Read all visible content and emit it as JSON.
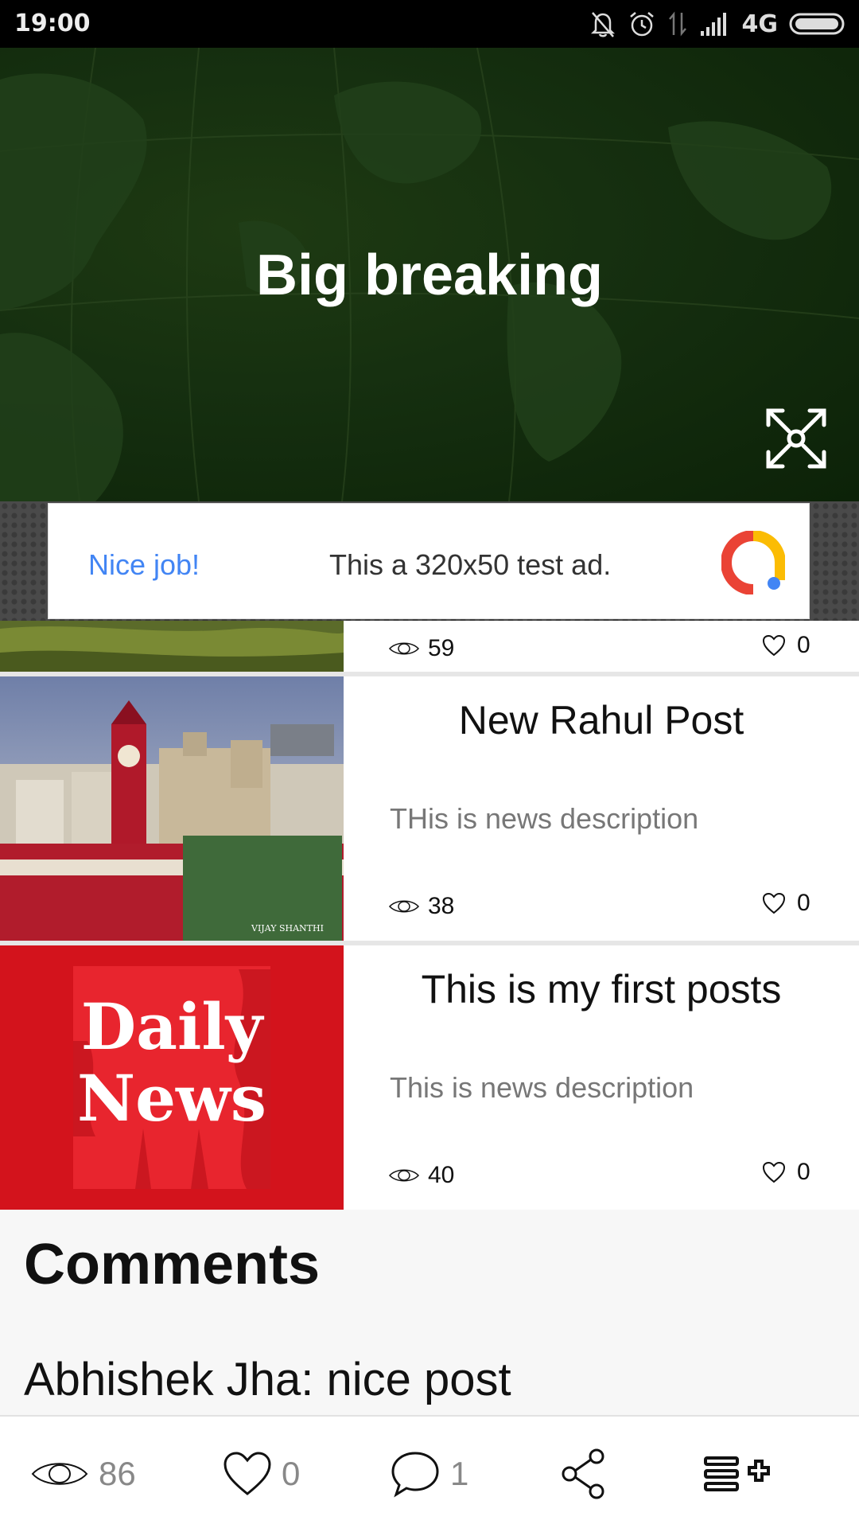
{
  "status_bar": {
    "time": "19:00",
    "network": "4G"
  },
  "hero": {
    "title": "Big breaking"
  },
  "ad": {
    "headline": "Nice job!",
    "text": "This a 320x50 test ad."
  },
  "news": [
    {
      "title": "",
      "description": "",
      "views": "59",
      "likes": "0"
    },
    {
      "title": "New Rahul Post",
      "description": "THis is news description",
      "views": "38",
      "likes": "0",
      "image_caption": "VIJAY SHANTHI"
    },
    {
      "title": "This is my first posts",
      "description": "This is news description",
      "views": "40",
      "likes": "0",
      "image_logo_text": "Daily News"
    }
  ],
  "comments": {
    "heading": "Comments",
    "items": [
      {
        "author": "Abhishek Jha:",
        "text": "nice post"
      }
    ]
  },
  "bottom_bar": {
    "views": "86",
    "likes": "0",
    "comments": "1"
  },
  "colors": {
    "hero_bg": "#163010",
    "ad_blue": "#4285f4",
    "daily_news_red": "#d3131c"
  },
  "icons": [
    "bell-off-icon",
    "alarm-icon",
    "data-arrows-icon",
    "signal-icon",
    "battery-icon",
    "expand-icon",
    "eye-icon",
    "heart-icon",
    "comment-icon",
    "share-icon",
    "playlist-add-icon"
  ]
}
